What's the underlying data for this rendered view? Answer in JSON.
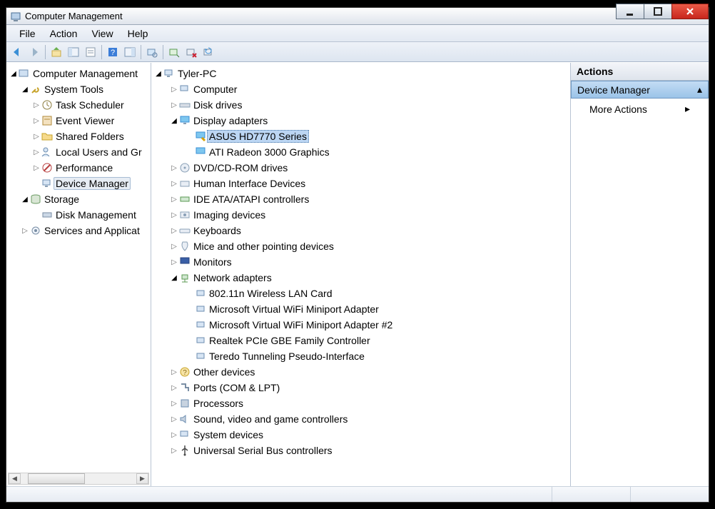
{
  "window": {
    "title": "Computer Management"
  },
  "menus": {
    "file": "File",
    "action": "Action",
    "view": "View",
    "help": "Help"
  },
  "actions_pane": {
    "header": "Actions",
    "category": "Device Manager",
    "more": "More Actions"
  },
  "left_tree": {
    "root": "Computer Management",
    "system_tools": "System Tools",
    "task_scheduler": "Task Scheduler",
    "event_viewer": "Event Viewer",
    "shared_folders": "Shared Folders",
    "local_users": "Local Users and Gr",
    "performance": "Performance",
    "device_manager": "Device Manager",
    "storage": "Storage",
    "disk_management": "Disk Management",
    "services": "Services and Applicat"
  },
  "mid_tree": {
    "root": "Tyler-PC",
    "computer": "Computer",
    "disk_drives": "Disk drives",
    "display_adapters": "Display adapters",
    "asus": "ASUS HD7770 Series",
    "ati": "ATI Radeon 3000 Graphics",
    "dvd": "DVD/CD-ROM drives",
    "hid": "Human Interface Devices",
    "ide": "IDE ATA/ATAPI controllers",
    "imaging": "Imaging devices",
    "keyboards": "Keyboards",
    "mice": "Mice and other pointing devices",
    "monitors": "Monitors",
    "network": "Network adapters",
    "wlan": "802.11n Wireless LAN Card",
    "vwifi1": "Microsoft Virtual WiFi Miniport Adapter",
    "vwifi2": "Microsoft Virtual WiFi Miniport Adapter #2",
    "realtek": "Realtek PCIe GBE Family Controller",
    "teredo": "Teredo Tunneling Pseudo-Interface",
    "other": "Other devices",
    "ports": "Ports (COM & LPT)",
    "processors": "Processors",
    "sound": "Sound, video and game controllers",
    "system_devices": "System devices",
    "usb": "Universal Serial Bus controllers"
  }
}
